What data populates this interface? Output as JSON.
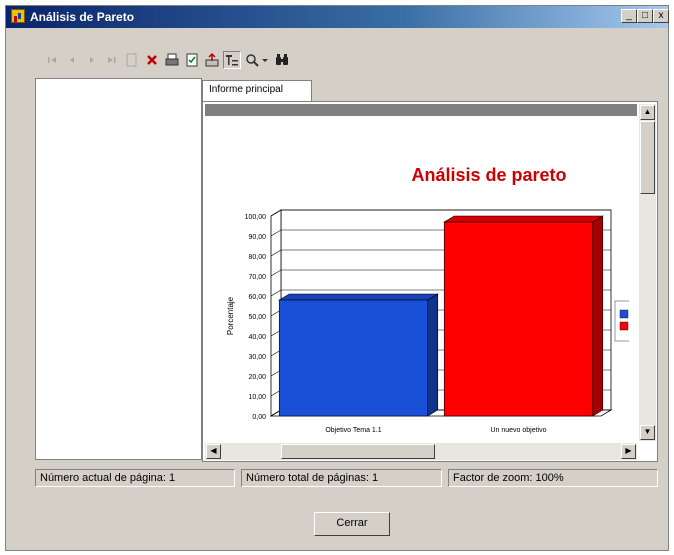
{
  "window": {
    "title": "Análisis de Pareto"
  },
  "window_buttons": {
    "minimize": "_",
    "maximize": "□",
    "close": "x"
  },
  "toolbar": {
    "items": [
      {
        "name": "first-page-icon",
        "glyph": "|◀",
        "enabled": false
      },
      {
        "name": "previous-page-icon",
        "glyph": "◀",
        "enabled": false
      },
      {
        "name": "next-page-icon",
        "glyph": "▶",
        "enabled": false
      },
      {
        "name": "last-page-icon",
        "glyph": "▶|",
        "enabled": false
      },
      {
        "name": "page-icon",
        "glyph": "▢",
        "enabled": false
      },
      {
        "name": "stop-icon",
        "glyph": "✕",
        "enabled": true
      },
      {
        "name": "print-icon",
        "glyph": "⎙",
        "enabled": true
      },
      {
        "name": "refresh-icon",
        "glyph": "⟳",
        "enabled": true
      },
      {
        "name": "export-icon",
        "glyph": "⇪",
        "enabled": true
      },
      {
        "name": "group-tree-icon",
        "glyph": "⊤",
        "enabled": true
      },
      {
        "name": "zoom-icon",
        "glyph": "🔍",
        "enabled": true
      },
      {
        "name": "zoom-dropdown-icon",
        "glyph": "▾",
        "enabled": true
      },
      {
        "name": "find-icon",
        "glyph": "♠",
        "enabled": true
      }
    ]
  },
  "tabs": {
    "main": "Informe principal"
  },
  "report": {
    "title": "Análisis de pareto"
  },
  "chart_data": {
    "type": "bar",
    "title": "Análisis de pareto",
    "ylabel": "Porcentaje",
    "categories": [
      "Objetivo Tema 1.1",
      "Un nuevo objetivo"
    ],
    "values": [
      58,
      97
    ],
    "colors": [
      "#1a4fd8",
      "#ff0000"
    ],
    "ylim": [
      0,
      100
    ],
    "yticks": [
      "0,00",
      "10,00",
      "20,00",
      "30,00",
      "40,00",
      "50,00",
      "60,00",
      "70,00",
      "80,00",
      "90,00",
      "100,00"
    ],
    "grid": true,
    "legend": {
      "position": "right",
      "colors": [
        "#1a4fd8",
        "#ff0000"
      ]
    }
  },
  "status": {
    "current_page": "Número actual de página: 1",
    "total_pages": "Número total de páginas: 1",
    "zoom": "Factor de zoom: 100%"
  },
  "buttons": {
    "close": "Cerrar"
  }
}
